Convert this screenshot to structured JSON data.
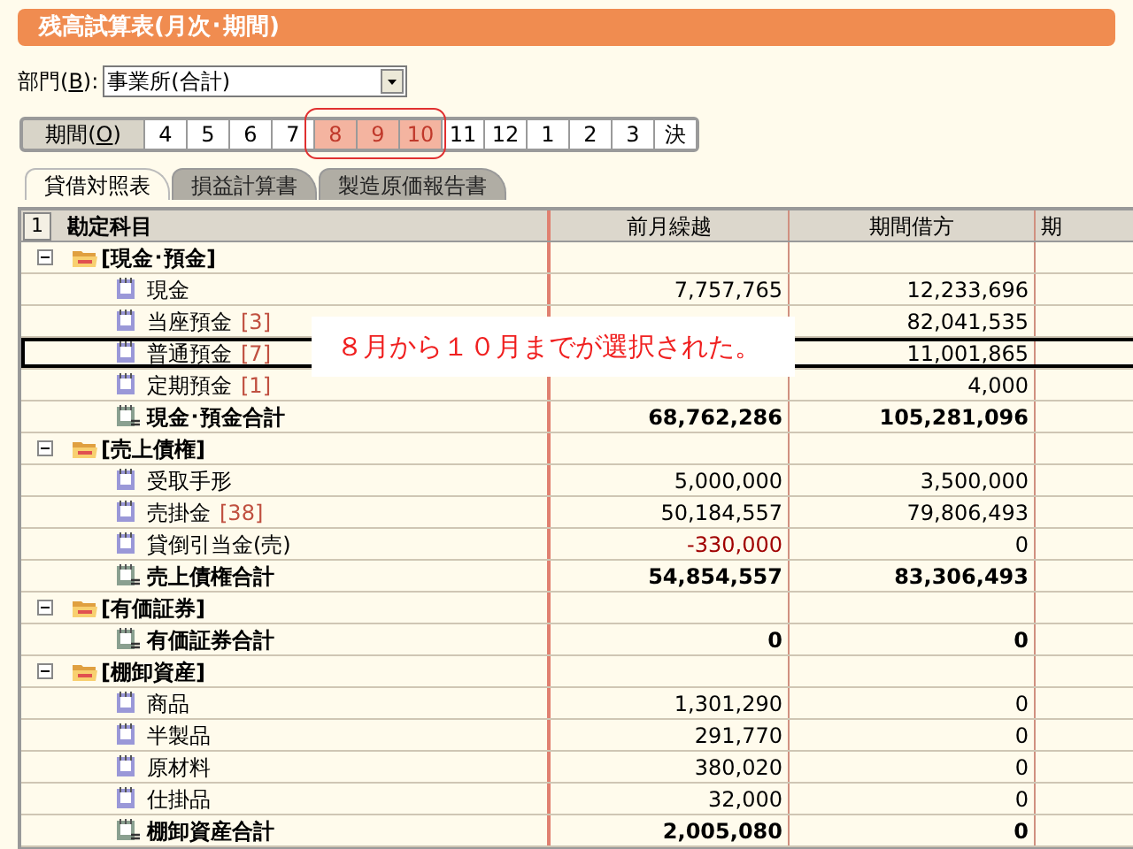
{
  "window": {
    "title": "残高試算表(月次･期間)"
  },
  "department": {
    "label": "部門(",
    "accel": "B",
    "label_end": "):",
    "value": "事業所(合計)"
  },
  "period": {
    "label": "期間(",
    "accel": "O",
    "label_end": ")",
    "items": [
      {
        "label": "4",
        "selected": false
      },
      {
        "label": "5",
        "selected": false
      },
      {
        "label": "6",
        "selected": false
      },
      {
        "label": "7",
        "selected": false
      },
      {
        "label": "8",
        "selected": true
      },
      {
        "label": "9",
        "selected": true
      },
      {
        "label": "10",
        "selected": true
      },
      {
        "label": "11",
        "selected": false
      },
      {
        "label": "12",
        "selected": false
      },
      {
        "label": "1",
        "selected": false
      },
      {
        "label": "2",
        "selected": false
      },
      {
        "label": "3",
        "selected": false
      },
      {
        "label": "決",
        "selected": false
      }
    ]
  },
  "tabs": [
    {
      "label": "貸借対照表",
      "selected": true
    },
    {
      "label": "損益計算書",
      "selected": false
    },
    {
      "label": "製造原価報告書",
      "selected": false
    }
  ],
  "table": {
    "level_button": "1",
    "columns": [
      "勘定科目",
      "前月繰越",
      "期間借方"
    ],
    "column_3": "期",
    "rows": [
      {
        "kind": "group",
        "name": "[現金･預金]",
        "expanded": true,
        "selected": false
      },
      {
        "kind": "item",
        "name": "現金",
        "prev": "7,757,765",
        "debit": "12,233,696",
        "selected": false
      },
      {
        "kind": "item",
        "name": "当座預金",
        "count": "[3]",
        "debit": "82,041,535",
        "selected": false
      },
      {
        "kind": "item",
        "name": "普通預金",
        "count": "[7]",
        "debit": "11,001,865",
        "selected": true
      },
      {
        "kind": "item",
        "name": "定期預金",
        "count": "[1]",
        "debit": "4,000",
        "selected": false
      },
      {
        "kind": "total",
        "name": "現金･預金合計",
        "prev": "68,762,286",
        "debit": "105,281,096",
        "selected": false
      },
      {
        "kind": "group",
        "name": "[売上債権]",
        "expanded": true,
        "selected": false
      },
      {
        "kind": "item",
        "name": "受取手形",
        "prev": "5,000,000",
        "debit": "3,500,000",
        "selected": false
      },
      {
        "kind": "item",
        "name": "売掛金",
        "count": "[38]",
        "prev": "50,184,557",
        "debit": "79,806,493",
        "selected": false
      },
      {
        "kind": "item",
        "name": "貸倒引当金(売)",
        "prev": "-330,000",
        "negative": true,
        "debit": "0",
        "selected": false
      },
      {
        "kind": "total",
        "name": "売上債権合計",
        "prev": "54,854,557",
        "debit": "83,306,493",
        "selected": false
      },
      {
        "kind": "group",
        "name": "[有価証券]",
        "expanded": true,
        "selected": false
      },
      {
        "kind": "total",
        "name": "有価証券合計",
        "prev": "0",
        "debit": "0",
        "selected": false
      },
      {
        "kind": "group",
        "name": "[棚卸資産]",
        "expanded": true,
        "selected": false
      },
      {
        "kind": "item",
        "name": "商品",
        "prev": "1,301,290",
        "debit": "0",
        "selected": false
      },
      {
        "kind": "item",
        "name": "半製品",
        "prev": "291,770",
        "debit": "0",
        "selected": false
      },
      {
        "kind": "item",
        "name": "原材料",
        "prev": "380,020",
        "debit": "0",
        "selected": false
      },
      {
        "kind": "item",
        "name": "仕掛品",
        "prev": "32,000",
        "debit": "0",
        "selected": false
      },
      {
        "kind": "total",
        "name": "棚卸資産合計",
        "prev": "2,005,080",
        "debit": "0",
        "selected": false
      }
    ]
  },
  "callout": "８月から１０月までが選択された。"
}
